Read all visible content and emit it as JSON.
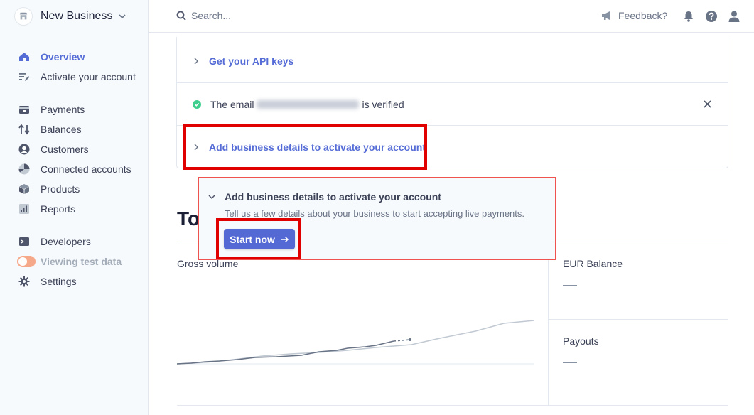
{
  "sidebar": {
    "business_name": "New Business",
    "items": [
      {
        "label": "Overview",
        "icon": "home-icon"
      },
      {
        "label": "Activate your account",
        "icon": "edit-list-icon"
      },
      {
        "label": "Payments",
        "icon": "payments-icon"
      },
      {
        "label": "Balances",
        "icon": "balances-icon"
      },
      {
        "label": "Customers",
        "icon": "customers-icon"
      },
      {
        "label": "Connected accounts",
        "icon": "connected-accounts-icon"
      },
      {
        "label": "Products",
        "icon": "products-icon"
      },
      {
        "label": "Reports",
        "icon": "reports-icon"
      },
      {
        "label": "Developers",
        "icon": "terminal-icon"
      },
      {
        "label": "Viewing test data",
        "icon": "toggle-icon"
      },
      {
        "label": "Settings",
        "icon": "gear-icon"
      }
    ]
  },
  "topbar": {
    "search_placeholder": "Search...",
    "feedback_label": "Feedback?"
  },
  "checklist": {
    "api_keys_label": "Get your API keys",
    "email_prefix": "The email",
    "email_suffix": "is verified",
    "business_details_label": "Add business details to activate your account"
  },
  "popover": {
    "title": "Add business details to activate your account",
    "description": "Tell us a few details about your business to start accepting live payments.",
    "button_label": "Start now"
  },
  "today": {
    "heading": "To",
    "gross_volume_label": "Gross volume",
    "eur_balance_label": "EUR Balance",
    "payouts_label": "Payouts"
  },
  "colors": {
    "accent": "#556cd6",
    "button": "#5469d4",
    "highlight": "#e00000",
    "success": "#3ecf8e"
  }
}
